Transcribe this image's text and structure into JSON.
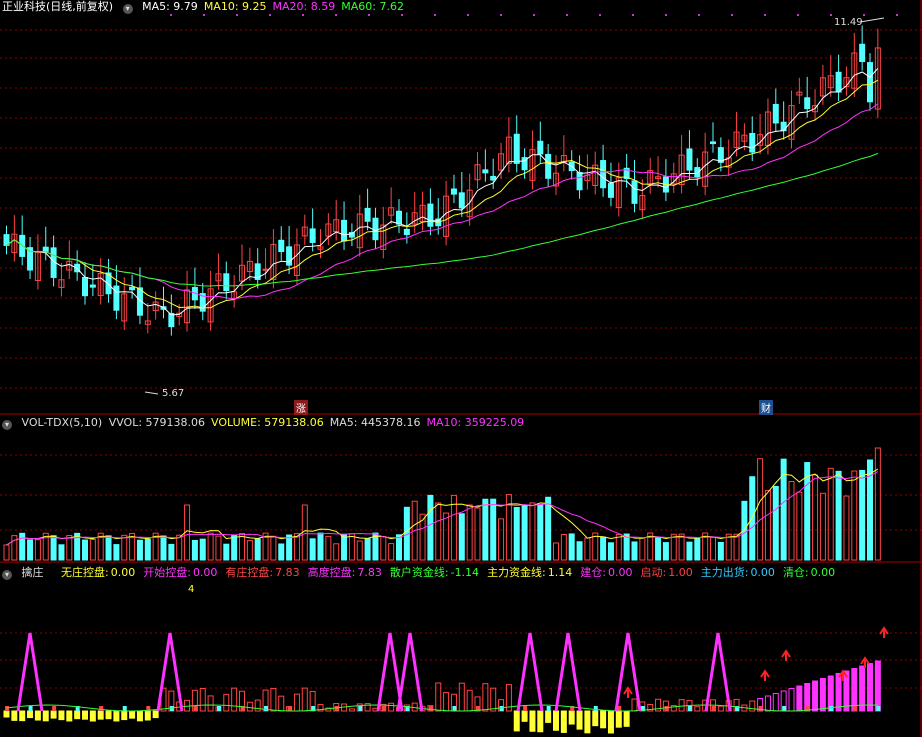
{
  "main": {
    "title": "正业科技(日线,前复权)",
    "ma": [
      {
        "label": "MA5: 9.79",
        "color": "#ffffff"
      },
      {
        "label": "MA10: 9.25",
        "color": "#ffff33"
      },
      {
        "label": "MA20: 8.59",
        "color": "#ff33ff"
      },
      {
        "label": "MA60: 7.62",
        "color": "#33ff33"
      }
    ],
    "high_label": "11.49",
    "low_label": "5.67",
    "tag_up": "涨",
    "tag_fin": "财"
  },
  "vol": {
    "title": "VOL-TDX(5,10)",
    "items": [
      {
        "label": "VVOL: 579138.06",
        "color": "#dddddd"
      },
      {
        "label": "VOLUME: 579138.06",
        "color": "#ffff33"
      },
      {
        "label": "MA5: 445378.16",
        "color": "#dddddd"
      },
      {
        "label": "MA10: 359225.09",
        "color": "#ff33ff"
      }
    ]
  },
  "ind": {
    "title": "擒庄",
    "items": [
      {
        "name": "无庄控盘:",
        "value": "0.00",
        "color": "#ffff33"
      },
      {
        "name": "开始控盘:",
        "value": "0.00",
        "color": "#ff33ff"
      },
      {
        "name": "有庄控盘:",
        "value": "7.83",
        "color": "#ff4444"
      },
      {
        "name": "高度控盘:",
        "value": "7.83",
        "color": "#ff33ff"
      },
      {
        "name": "散户资金线:",
        "value": "-1.14",
        "color": "#33ff33"
      },
      {
        "name": "主力资金线:",
        "value": "1.14",
        "color": "#ffff33"
      },
      {
        "name": "建仓:",
        "value": "0.00",
        "color": "#ff33ff"
      },
      {
        "name": "启动:",
        "value": "1.00",
        "color": "#ff4444"
      },
      {
        "name": "主力出货:",
        "value": "0.00",
        "color": "#33ccff"
      },
      {
        "name": "清仓:",
        "value": "0.00",
        "color": "#33ff33"
      }
    ],
    "sub_value": "4"
  },
  "colors": {
    "up": "#ff4444",
    "down": "#54ffff",
    "grid": "#8b0000"
  }
}
